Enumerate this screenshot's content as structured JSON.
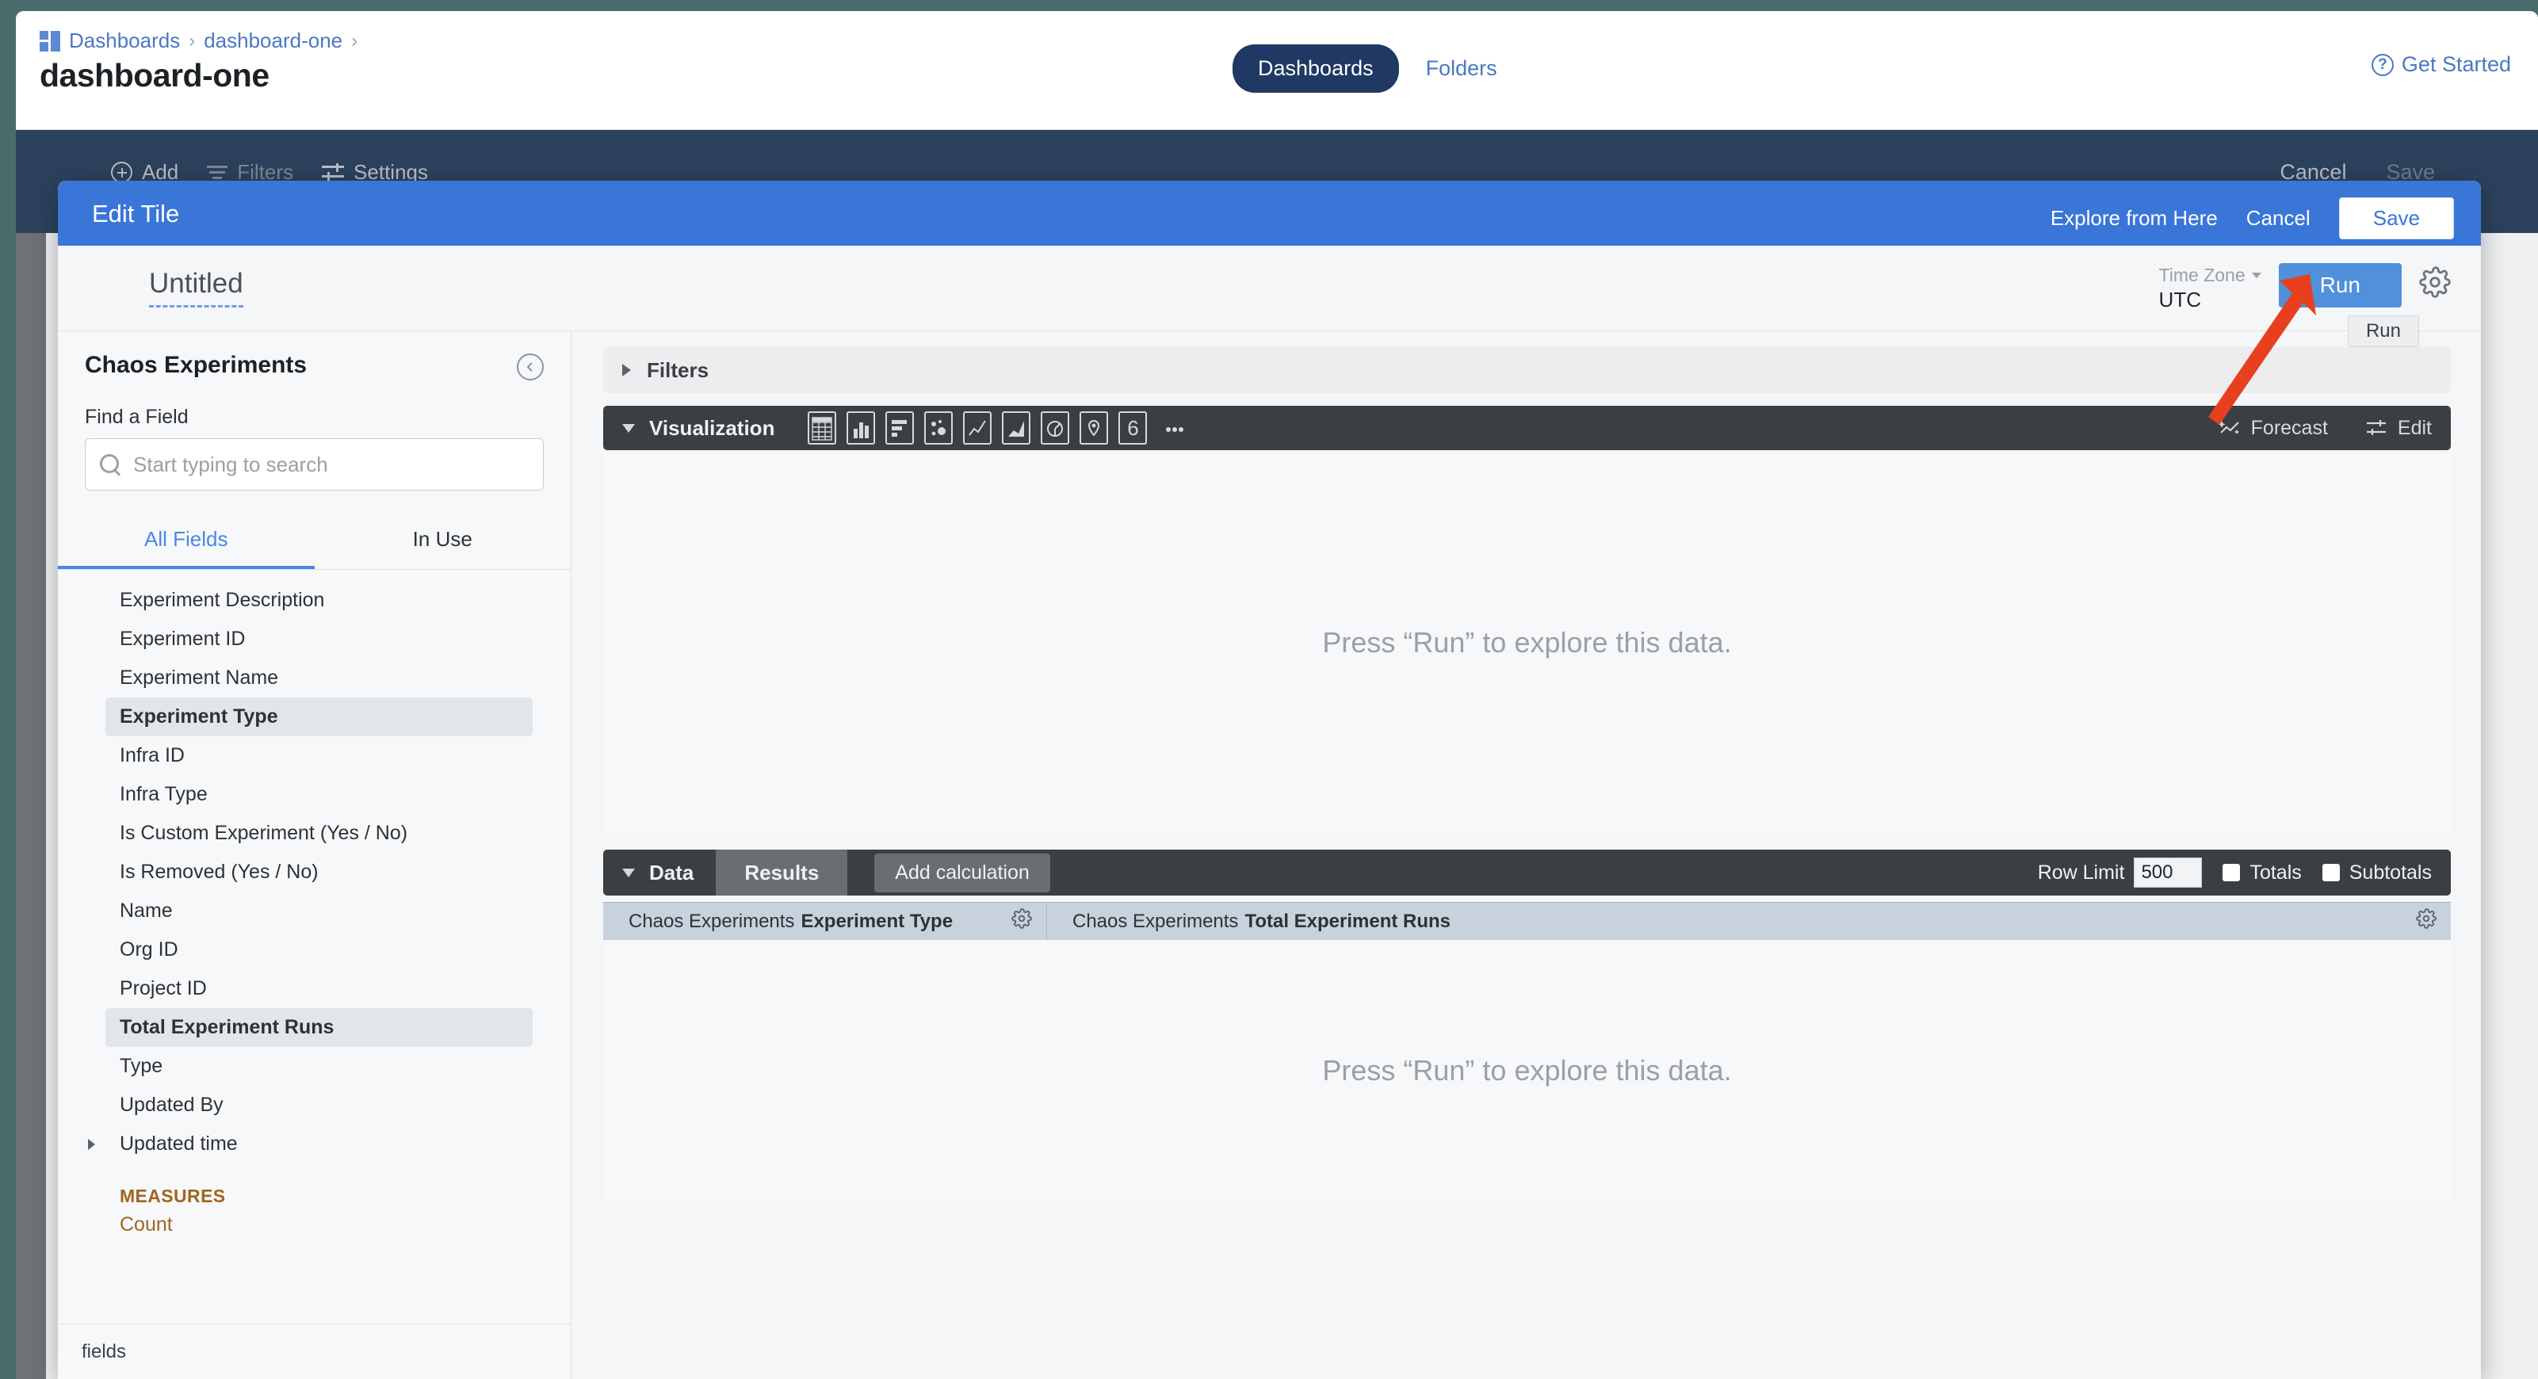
{
  "app": {
    "breadcrumb": {
      "icon": "dashboards-grid-icon",
      "items": [
        "Dashboards",
        "dashboard-one"
      ],
      "separator": "›"
    },
    "page_title": "dashboard-one",
    "nav": {
      "active_tab": "Dashboards",
      "other_tab": "Folders"
    },
    "get_started": {
      "label": "Get Started",
      "icon": "question-circle-icon"
    },
    "dashboard_toolbar": {
      "add": "Add",
      "filters": "Filters",
      "settings": "Settings",
      "cancel": "Cancel",
      "save": "Save"
    }
  },
  "modal": {
    "title": "Edit Tile",
    "explore_from_here": "Explore from Here",
    "cancel": "Cancel",
    "save": "Save"
  },
  "explore": {
    "tile_name": "Untitled",
    "time_zone_label": "Time Zone",
    "time_zone_value": "UTC",
    "run_button": "Run",
    "run_tooltip": "Run",
    "settings_gear": "gear-icon"
  },
  "sidebar": {
    "title": "Chaos Experiments",
    "collapse_icon": "chevron-left-circle-icon",
    "find_label": "Find a Field",
    "search_placeholder": "Start typing to search",
    "search_value": "",
    "tabs": [
      {
        "label": "All Fields",
        "active": true
      },
      {
        "label": "In Use",
        "active": false
      }
    ],
    "fields": [
      {
        "label": "Experiment Description",
        "selected": false,
        "expandable": false
      },
      {
        "label": "Experiment ID",
        "selected": false,
        "expandable": false
      },
      {
        "label": "Experiment Name",
        "selected": false,
        "expandable": false
      },
      {
        "label": "Experiment Type",
        "selected": true,
        "expandable": false
      },
      {
        "label": "Infra ID",
        "selected": false,
        "expandable": false
      },
      {
        "label": "Infra Type",
        "selected": false,
        "expandable": false
      },
      {
        "label": "Is Custom Experiment (Yes / No)",
        "selected": false,
        "expandable": false
      },
      {
        "label": "Is Removed (Yes / No)",
        "selected": false,
        "expandable": false
      },
      {
        "label": "Name",
        "selected": false,
        "expandable": false
      },
      {
        "label": "Org ID",
        "selected": false,
        "expandable": false
      },
      {
        "label": "Project ID",
        "selected": false,
        "expandable": false
      },
      {
        "label": "Total Experiment Runs",
        "selected": true,
        "expandable": false
      },
      {
        "label": "Type",
        "selected": false,
        "expandable": false
      },
      {
        "label": "Updated By",
        "selected": false,
        "expandable": false
      },
      {
        "label": "Updated time",
        "selected": false,
        "expandable": true
      }
    ],
    "measures_group": "MEASURES",
    "measures": [
      "Count"
    ],
    "footer": "fields"
  },
  "main": {
    "filters_section": "Filters",
    "visualization_section": "Visualization",
    "viz_icons": [
      "table-icon",
      "column-chart-icon",
      "bar-chart-icon",
      "scatter-plot-icon",
      "line-chart-icon",
      "area-chart-icon",
      "pie-chart-icon",
      "map-pin-icon",
      "single-value-icon",
      "more-options-icon"
    ],
    "single_value_glyph": "6",
    "forecast": "Forecast",
    "edit": "Edit",
    "viz_empty_message": "Press “Run” to explore this data.",
    "data_section": "Data",
    "results_tab": "Results",
    "add_calculation": "Add calculation",
    "row_limit_label": "Row Limit",
    "row_limit_value": "500",
    "totals_label": "Totals",
    "totals_checked": false,
    "subtotals_label": "Subtotals",
    "subtotals_checked": false,
    "results_columns": [
      {
        "view": "Chaos Experiments",
        "field": "Experiment Type"
      },
      {
        "view": "Chaos Experiments",
        "field": "Total Experiment Runs"
      }
    ],
    "results_empty_message": "Press “Run” to explore this data."
  },
  "annotation": {
    "type": "red-arrow",
    "points_to": "run-button",
    "color": "#E8401F"
  },
  "colors": {
    "modal_header": "#3a75d8",
    "run_button": "#5190da",
    "dark_bar": "#3c3f41",
    "nav_pill": "#1f3864",
    "link_blue": "#4a78c4",
    "measures_orange": "#a0651e",
    "results_header": "#c8d2dc",
    "page_chrome": "#2c425c"
  }
}
